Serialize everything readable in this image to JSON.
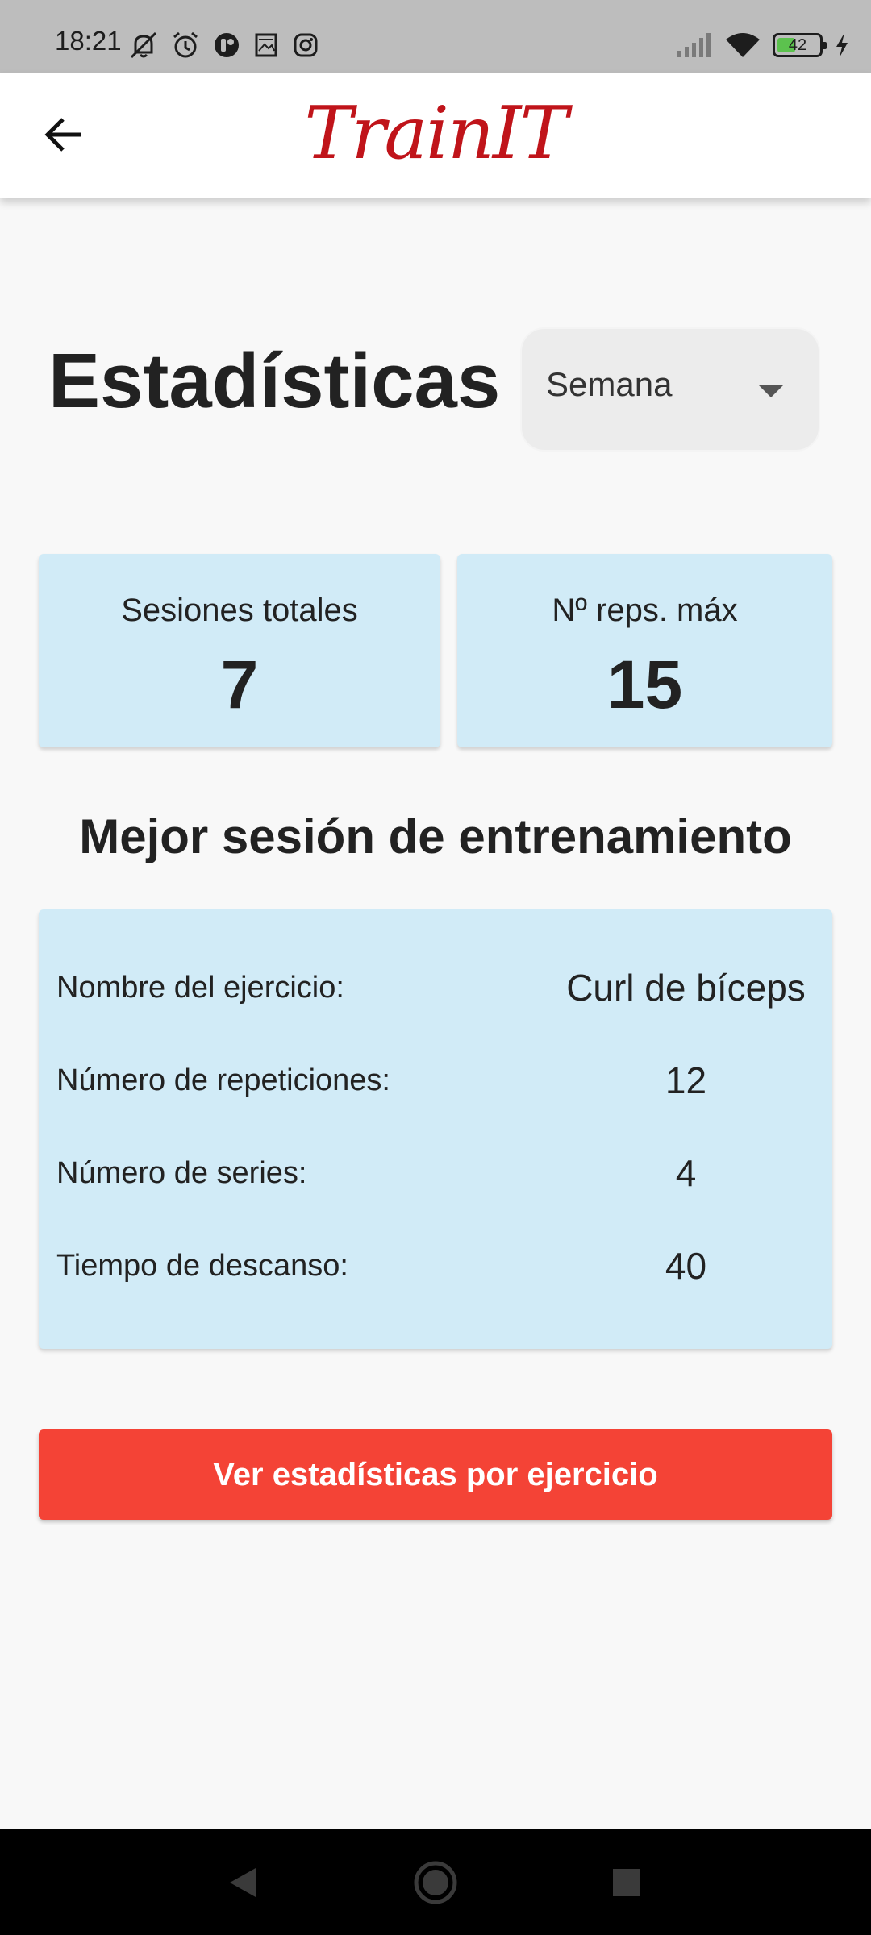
{
  "status_bar": {
    "time": "18:21",
    "left_icons": [
      "muted-bell-icon",
      "alarm-icon",
      "app-notification-icon",
      "gallery-notification-icon",
      "instagram-icon"
    ],
    "right_icons": [
      "signal-icon",
      "wifi-icon",
      "battery-icon",
      "charging-icon"
    ],
    "battery_level": "42",
    "battery_fraction": 0.42,
    "battery_color": "#5cc24e"
  },
  "app_bar": {
    "back_icon": "arrow-left-icon",
    "logo_text": "TrainIT",
    "logo_color": "#c0141a"
  },
  "header": {
    "title": "Estadísticas",
    "period_select": {
      "value": "Semana",
      "icon": "dropdown-arrow-icon"
    }
  },
  "summary": {
    "sessions_label": "Sesiones totales",
    "sessions_value": "7",
    "max_reps_label": "Nº reps. máx",
    "max_reps_value": "15",
    "card_color": "#d1ebf7"
  },
  "best_session": {
    "title": "Mejor sesión de entrenamiento",
    "rows": [
      {
        "label": "Nombre del ejercicio:",
        "value": "Curl de bíceps"
      },
      {
        "label": "Número de repeticiones:",
        "value": "12"
      },
      {
        "label": "Número de series:",
        "value": "4"
      },
      {
        "label": "Tiempo de descanso:",
        "value": "40"
      }
    ]
  },
  "actions": {
    "exercise_stats_label": "Ver estadísticas por ejercicio",
    "button_color": "#f44336"
  },
  "nav_bar": {
    "icons": [
      "back-triangle-icon",
      "home-circle-icon",
      "recents-square-icon"
    ]
  }
}
